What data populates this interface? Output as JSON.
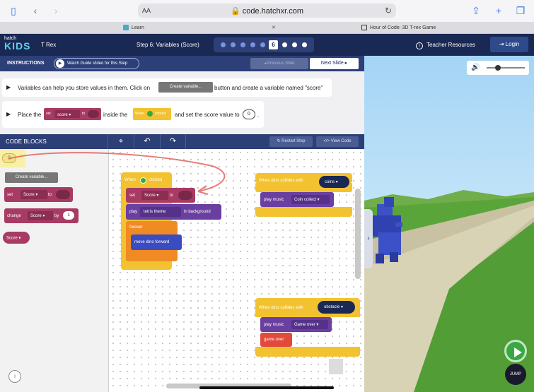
{
  "browser": {
    "address_text_size": "AA",
    "url": "code.hatchxr.com",
    "tabs": [
      {
        "label": "Learn"
      },
      {
        "label": "Hour of Code: 3D T-rex Game"
      }
    ]
  },
  "header": {
    "logo_small": "hatch",
    "logo_big": "KIDS",
    "project": "T Rex",
    "step_title": "Step 6: Variables (Score)",
    "current_step": "6",
    "teacher": "Teacher Resources",
    "login": "Login"
  },
  "instructions": {
    "title": "INSTRUCTIONS",
    "watch_video": "Watch Guide Video for this Step",
    "prev": "Previous Slide",
    "next": "Next Slide",
    "row1": {
      "text_a": "Variables can help you store values in them. Click on",
      "button": "Create variable...",
      "text_b": "button and create a variable named \"score\""
    },
    "row2": {
      "text_a": "Place the",
      "mini_set": "set",
      "mini_score": "score",
      "mini_to": "to",
      "text_b": "inside the",
      "mini_when": "When",
      "mini_clicked": "clicked",
      "text_c": "and set the score value to",
      "value": "0",
      "text_d": "."
    }
  },
  "code_toolbar": {
    "title": "CODE BLOCKS",
    "restart": "Restart Step",
    "view_code": "View Code"
  },
  "palette": {
    "var_bubble": "0",
    "create_variable": "Create variable...",
    "set_block": {
      "label": "set",
      "var": "Score",
      "to": "to"
    },
    "change_block": {
      "label": "change",
      "var": "Score",
      "by": "by",
      "value": "1"
    },
    "var_block": {
      "var": "Score"
    }
  },
  "workspace": {
    "when_clicked": {
      "when": "When",
      "clicked": "clicked"
    },
    "set_block": {
      "label": "set",
      "var": "Score",
      "to": "to"
    },
    "play_block": {
      "label": "play",
      "theme": "tetris theme",
      "suffix": "in background"
    },
    "forever": "forever",
    "move_forward": "move dino forward",
    "coins_event": {
      "label": "When dino collides with",
      "target": "coins"
    },
    "coins_music": {
      "label": "play music",
      "sound": "Coin collect"
    },
    "obstacle_event": {
      "label": "When dino collides with",
      "target": "obstacle"
    },
    "obstacle_music": {
      "label": "play music",
      "sound": "Game over"
    },
    "game_over": "game over"
  },
  "game": {
    "jump": "JUMP",
    "volume_percent": 30
  },
  "colors": {
    "header": "#1a2854",
    "event_yellow": "#f2c230",
    "variable_pink": "#a83b64",
    "sound_purple": "#6a3fa0",
    "motion_blue": "#3b4cc0",
    "control_orange": "#f08a24",
    "gameover_red": "#e24a3b"
  }
}
